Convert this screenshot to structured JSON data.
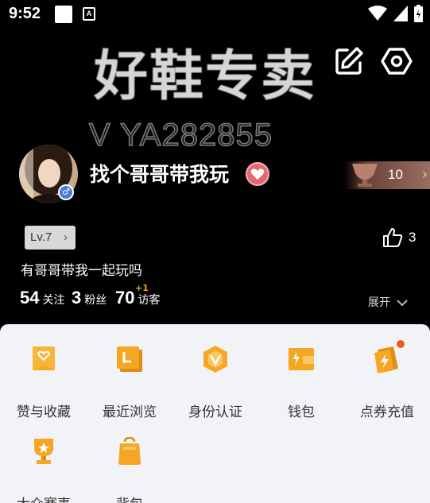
{
  "status_bar": {
    "time": "9:52",
    "notif_letter": "A"
  },
  "banner": {
    "title": "好鞋专卖",
    "subtitle": "V YA282855"
  },
  "profile": {
    "nickname": "找个哥哥带我玩",
    "gender_symbol": "♂",
    "honor_count": "10",
    "level": "Lv.7",
    "like_count": "3",
    "bio": "有哥哥带我一起玩吗",
    "stats": {
      "following": {
        "num": "54",
        "label": "关注"
      },
      "fans": {
        "num": "3",
        "label": "粉丝"
      },
      "visitors": {
        "num": "70",
        "label": "访客",
        "delta": "+1"
      }
    },
    "expand_label": "展开"
  },
  "menu": [
    {
      "label": "赞与收藏",
      "icon": "heart-folder-icon"
    },
    {
      "label": "最近浏览",
      "icon": "recent-icon"
    },
    {
      "label": "身份认证",
      "icon": "verify-icon"
    },
    {
      "label": "钱包",
      "icon": "wallet-icon"
    },
    {
      "label": "点券充值",
      "icon": "coupon-icon"
    },
    {
      "label": "大众赛事",
      "icon": "trophy-icon"
    },
    {
      "label": "背包",
      "icon": "backpack-icon"
    }
  ],
  "colors": {
    "accent": "#f5a623",
    "panel": "#f2f3f7",
    "heart": "#e26a72",
    "gender": "#4a7bd8"
  }
}
